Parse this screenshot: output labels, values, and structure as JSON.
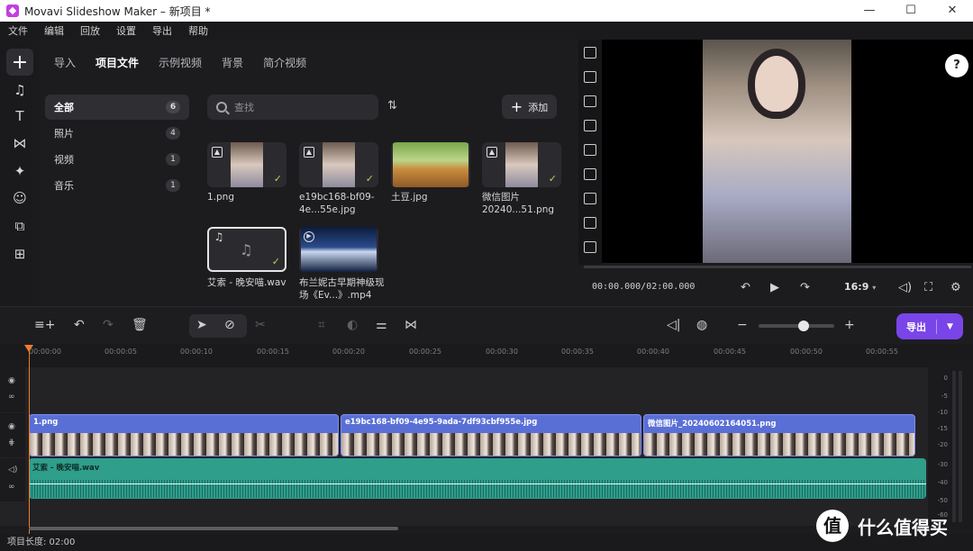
{
  "window": {
    "title": "Movavi Slideshow Maker – 新项目 *",
    "controls": {
      "minimize": "—",
      "maximize": "☐",
      "close": "✕"
    }
  },
  "menu": [
    "文件",
    "编辑",
    "回放",
    "设置",
    "导出",
    "帮助"
  ],
  "sidebar_icons": [
    "add-icon",
    "music-icon",
    "text-icon",
    "transition-icon",
    "effects-icon",
    "sticker-icon",
    "shapes-icon",
    "more-apps-icon"
  ],
  "tabs": [
    {
      "label": "导入",
      "active": false
    },
    {
      "label": "项目文件",
      "active": true
    },
    {
      "label": "示例视频",
      "active": false
    },
    {
      "label": "背景",
      "active": false
    },
    {
      "label": "简介视频",
      "active": false
    }
  ],
  "categories": [
    {
      "label": "全部",
      "count": "6",
      "active": true
    },
    {
      "label": "照片",
      "count": "4",
      "active": false
    },
    {
      "label": "视频",
      "count": "1",
      "active": false
    },
    {
      "label": "音乐",
      "count": "1",
      "active": false
    }
  ],
  "search": {
    "placeholder": "查找"
  },
  "add_button": {
    "label": "添加"
  },
  "media": [
    {
      "label": "1.png",
      "type": "image",
      "checked": true
    },
    {
      "label": "e19bc168-bf09-4e...55e.jpg",
      "type": "image",
      "checked": true
    },
    {
      "label": "土豆.jpg",
      "type": "image",
      "checked": false
    },
    {
      "label": "微信图片 20240...51.png",
      "type": "image",
      "checked": true
    },
    {
      "label": "艾索 - 晚安喵.wav",
      "type": "audio",
      "checked": true
    },
    {
      "label": "布兰妮古早期神级现场《Ev...》.mp4",
      "type": "video",
      "checked": false
    }
  ],
  "player": {
    "timecode": "00:00.000/02:00.000",
    "aspect_ratio": "16:9",
    "progress": 0
  },
  "toolbar": {
    "export_label": "导出"
  },
  "ruler": [
    "00:00:00",
    "00:00:05",
    "00:00:10",
    "00:00:15",
    "00:00:20",
    "00:00:25",
    "00:00:30",
    "00:00:35",
    "00:00:40",
    "00:00:45",
    "00:00:50",
    "00:00:55"
  ],
  "clips": [
    {
      "label": "1.png"
    },
    {
      "label": "e19bc168-bf09-4e95-9ada-7df93cbf955e.jpg"
    },
    {
      "label": "微信图片_20240602164051.png"
    }
  ],
  "audio_clip": {
    "label": "艾索 - 晚安喵.wav"
  },
  "meter_labels": [
    "0",
    "-5",
    "-10",
    "-15",
    "-20",
    "-30",
    "-40",
    "-50",
    "-60"
  ],
  "status": {
    "project_length": "项目长度: 02:00"
  },
  "watermark": {
    "logo": "值",
    "text": "什么值得买"
  }
}
